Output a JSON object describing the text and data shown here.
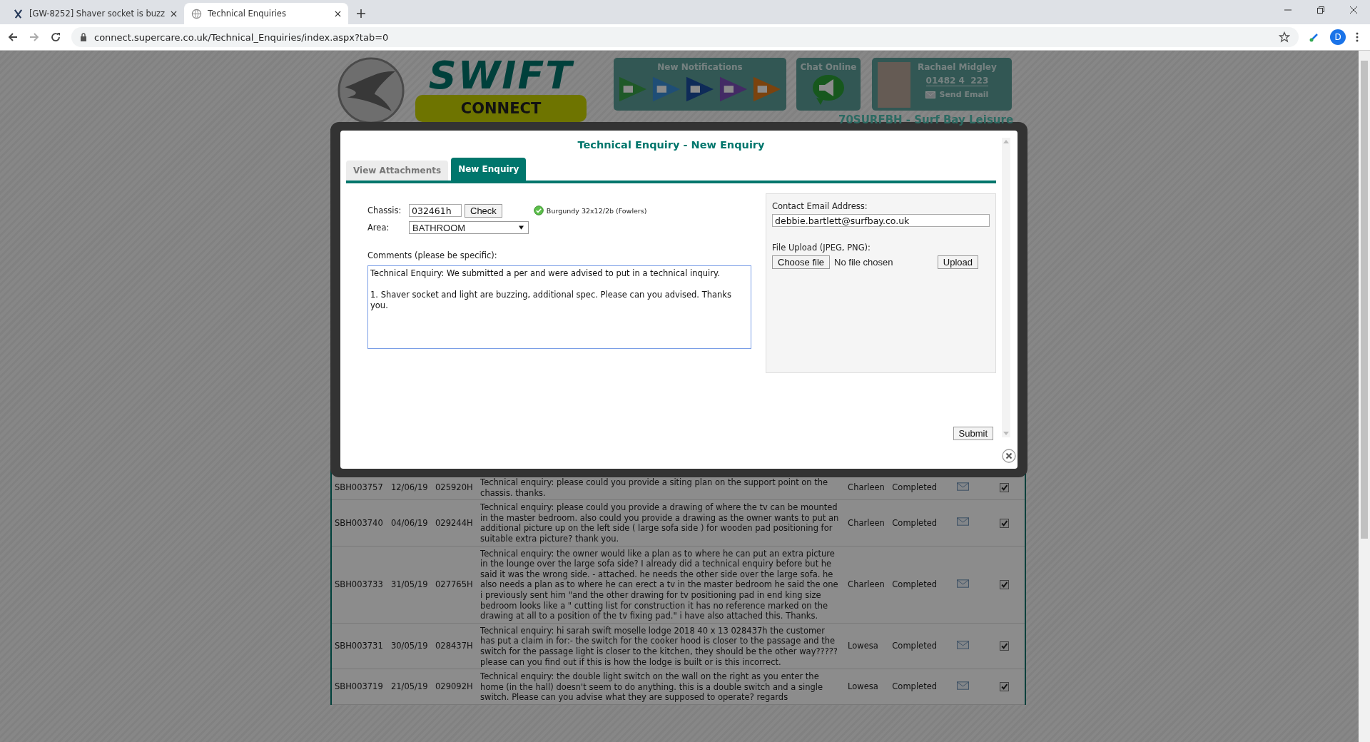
{
  "browser": {
    "tabs": [
      {
        "title": "[GW-8252] Shaver socket is buzz",
        "selected": false
      },
      {
        "title": "Technical Enquiries",
        "selected": true
      }
    ],
    "url": "connect.supercare.co.uk/Technical_Enquiries/index.aspx?tab=0",
    "profile": "D"
  },
  "header": {
    "logo_top": "SWIFT",
    "logo_bottom": "CONNECT",
    "notifications_title": "New Notifications",
    "chat_title": "Chat Online",
    "contact": {
      "name": "Rachael Midgley",
      "phone": "01482 4  223",
      "send_email": "Send Email"
    },
    "dealer": "70SURFBH - Surf Bay Leisure"
  },
  "modal": {
    "title": "Technical Enquiry - New Enquiry",
    "tabs": [
      {
        "label": "View Attachments",
        "selected": false
      },
      {
        "label": "New Enquiry",
        "selected": true
      }
    ],
    "chassis_label": "Chassis:",
    "chassis": "032461h",
    "check_button": "Check",
    "vehicle": "Burgundy 32x12/2b (Fowlers)",
    "area_label": "Area:",
    "area": "BATHROOM",
    "comments_label": "Comments (please be specific):",
    "comments": "Technical Enquiry: We submitted a per and were advised to put in a technical inquiry.\n\n1. Shaver socket and light are buzzing, additional spec. Please can you advised. Thanks you.",
    "email_label": "Contact Email Address:",
    "email": "debbie.bartlett@surfbay.co.uk",
    "file_label": "File Upload (JPEG, PNG):",
    "choose_file": "Choose file",
    "no_file": "No file chosen",
    "upload_button": "Upload",
    "submit_button": "Submit"
  },
  "table": {
    "rows": [
      {
        "ref": "SBH003757",
        "date": "12/06/19",
        "chassis": "025920H",
        "description": "Technical enquiry: please could you provide a siting plan on the support point on the chassis. thanks.",
        "handler": "Charleen",
        "status": "Completed",
        "done": true
      },
      {
        "ref": "SBH003740",
        "date": "04/06/19",
        "chassis": "029244H",
        "description": "Technical enquiry: please could you provide a drawing of where the tv can be mounted in the master bedroom. also could you provide a drawing as the owner wants to put an additional picture up on the left side ( large sofa side ) for wooden pad positioning for suitable extra picture? thank you.",
        "handler": "Charleen",
        "status": "Completed",
        "done": true
      },
      {
        "ref": "SBH003733",
        "date": "31/05/19",
        "chassis": "027765H",
        "description": "Technical enquiry: the owner would like a plan as to where he can put an extra picture in the lounge over the large sofa side? I already did a technical enquiry before but he said it was the wrong side. - attached. he needs the other side over the large sofa. he also needs a plan as to where he can erect a tv in the master bedroom he said the one i previously sent him \"and the other drawing for tv positioning pad in end king size bedroom looks like a \" cutting list for construction it has no reference marked on the drawing at all to a position of the tv fixing pad.\" i have also attached this. Thanks.",
        "handler": "Charleen",
        "status": "Completed",
        "done": true
      },
      {
        "ref": "SBH003731",
        "date": "30/05/19",
        "chassis": "028437H",
        "description": "Technical enquiry: hi sarah swift moselle lodge 2018 40 x 13 028437h the customer has put a claim in for:- the switch for the cooker hood is closer to the passage and the switch for the passage light is closer to the kitchen, they should be the other way????? please can you find out if this is how the lodge is built or is this incorrect.",
        "handler": "Lowesa",
        "status": "Completed",
        "done": true
      },
      {
        "ref": "SBH003719",
        "date": "21/05/19",
        "chassis": "029092H",
        "description": "Technical enquiry: the double light switch on the wall on the right as you enter the home (in the hall) doesn't seem to do anything. this is a double switch and a single switch. Please can you advise what they are supposed to operate? regards",
        "handler": "Lowesa",
        "status": "Completed",
        "done": true
      }
    ]
  }
}
